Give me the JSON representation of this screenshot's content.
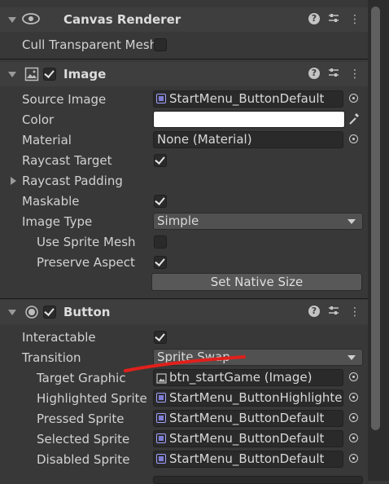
{
  "canvas_renderer": {
    "title": "Canvas Renderer",
    "cull_label": "Cull Transparent Mesh",
    "cull_checked": false
  },
  "image": {
    "title": "Image",
    "enabled": true,
    "source_image_label": "Source Image",
    "source_image_value": "StartMenu_ButtonDefault",
    "color_label": "Color",
    "color_value": "#ffffff",
    "material_label": "Material",
    "material_value": "None (Material)",
    "raycast_target_label": "Raycast Target",
    "raycast_target_checked": true,
    "raycast_padding_label": "Raycast Padding",
    "maskable_label": "Maskable",
    "maskable_checked": true,
    "image_type_label": "Image Type",
    "image_type_value": "Simple",
    "use_sprite_mesh_label": "Use Sprite Mesh",
    "use_sprite_mesh_checked": false,
    "preserve_aspect_label": "Preserve Aspect",
    "preserve_aspect_checked": true,
    "set_native_size_label": "Set Native Size"
  },
  "button": {
    "title": "Button",
    "enabled": true,
    "interactable_label": "Interactable",
    "interactable_checked": true,
    "transition_label": "Transition",
    "transition_value": "Sprite Swap",
    "target_graphic_label": "Target Graphic",
    "target_graphic_value": "btn_startGame (Image)",
    "highlighted_sprite_label": "Highlighted Sprite",
    "highlighted_sprite_value": "StartMenu_ButtonHighlighted",
    "pressed_sprite_label": "Pressed Sprite",
    "pressed_sprite_value": "StartMenu_ButtonDefault",
    "selected_sprite_label": "Selected Sprite",
    "selected_sprite_value": "StartMenu_ButtonDefault",
    "disabled_sprite_label": "Disabled Sprite",
    "disabled_sprite_value": "StartMenu_ButtonDefault"
  },
  "header_icons": {
    "help": "?",
    "preset": "preset-icon",
    "menu": "⋮"
  },
  "colors": {
    "annotation_red": "#e0201c",
    "panel_bg": "#383838",
    "header_bg": "#3e3e3e"
  }
}
